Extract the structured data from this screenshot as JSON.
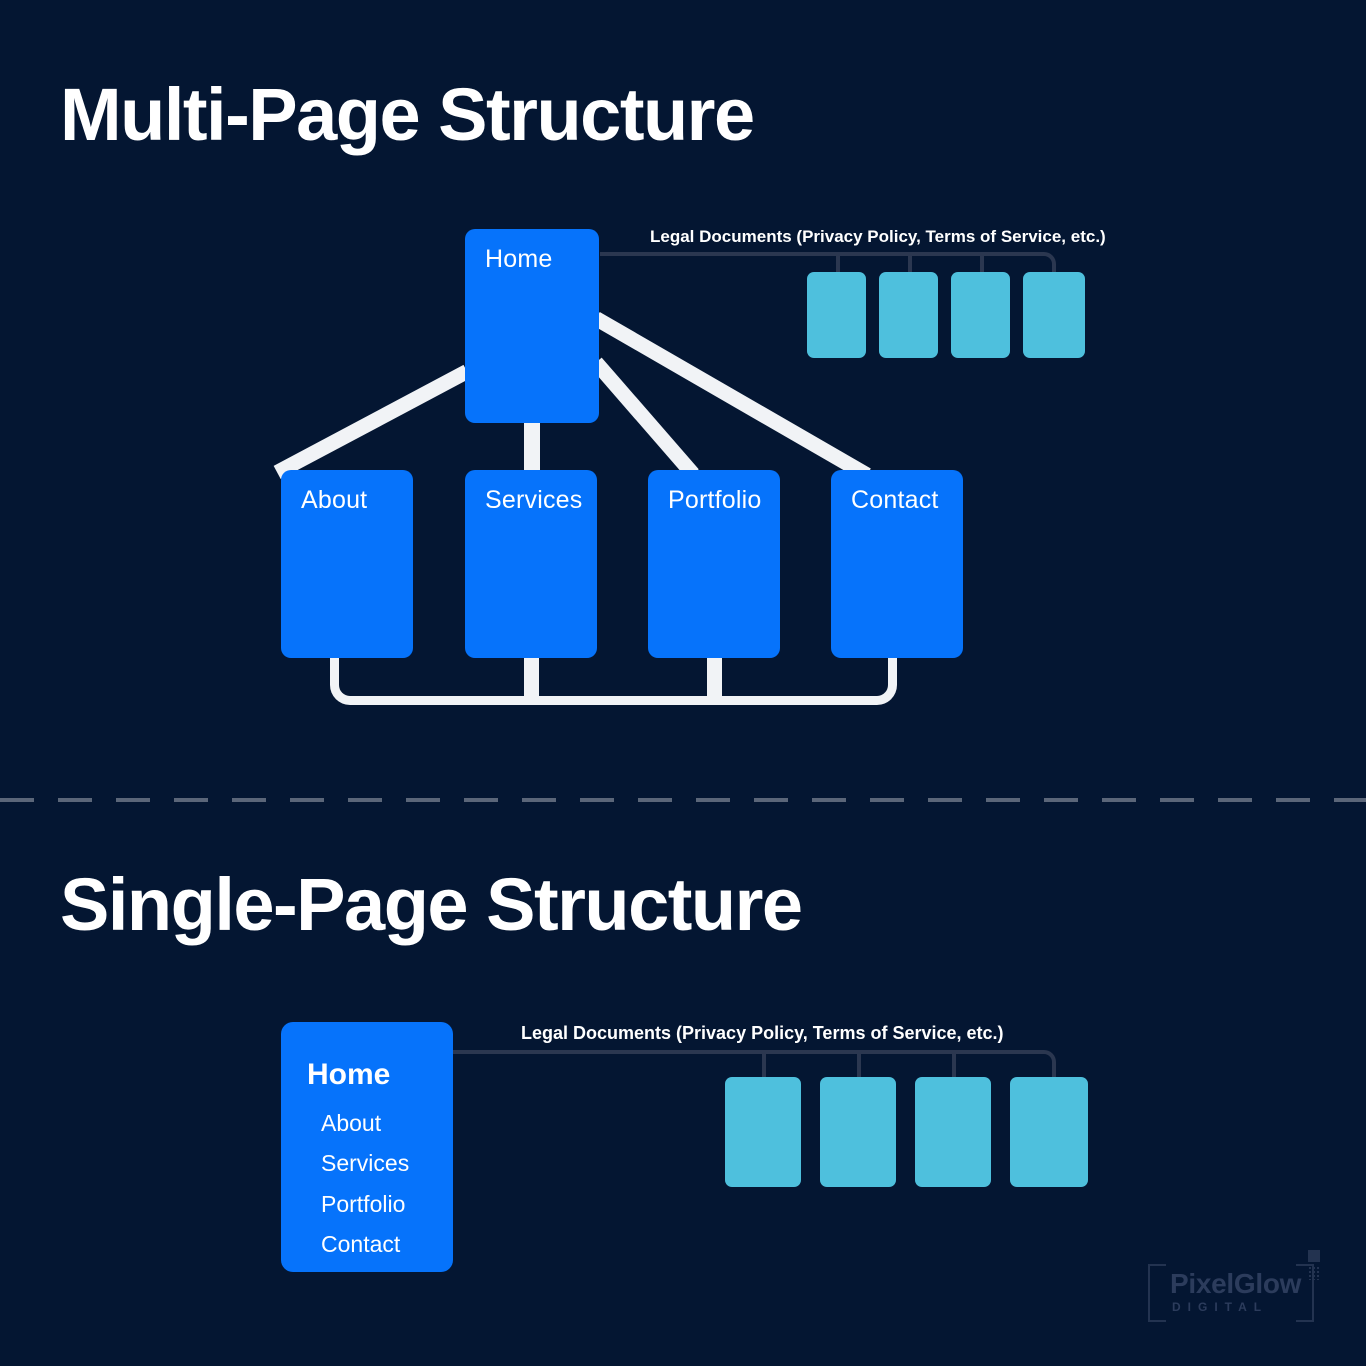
{
  "theme": {
    "background": "#041632",
    "node_blue": "#0673fb",
    "legal_cyan": "#4ec0dd",
    "wire_white": "#f1f3f6",
    "legal_wire": "#2b3750",
    "title_white": "#ffffff",
    "divider_gray": "#5b6679",
    "watermark_gray": "#2c3c5c"
  },
  "sections": {
    "multi": {
      "title": "Multi-Page Structure",
      "root": {
        "label": "Home"
      },
      "children": [
        {
          "label": "About"
        },
        {
          "label": "Services"
        },
        {
          "label": "Portfolio"
        },
        {
          "label": "Contact"
        }
      ],
      "legal": {
        "caption": "Legal Documents (Privacy Policy, Terms of Service, etc.)",
        "count": 4
      }
    },
    "single": {
      "title": "Single-Page Structure",
      "root": {
        "label": "Home"
      },
      "sections_list": [
        {
          "label": "About"
        },
        {
          "label": "Services"
        },
        {
          "label": "Portfolio"
        },
        {
          "label": "Contact"
        }
      ],
      "legal": {
        "caption": "Legal Documents (Privacy Policy, Terms of Service, etc.)",
        "count": 4
      }
    }
  },
  "watermark": {
    "name": "PixelGlow",
    "tagline": "DIGITAL"
  }
}
